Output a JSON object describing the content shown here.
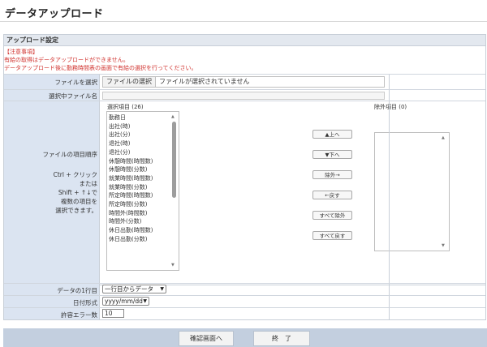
{
  "page": {
    "title": "データアップロード"
  },
  "section": {
    "header": "アップロード設定",
    "notice_label": "【注意事項】",
    "notice_lines": [
      "有給の取得はデータアップロードができません。",
      "データアップロード後に勤務時間表の画面で有給の選択を行ってください。"
    ]
  },
  "file_row": {
    "label": "ファイルを選択",
    "button_label": "ファイルの選択",
    "status": "ファイルが選択されていません"
  },
  "selected_row": {
    "label": "選択中ファイル名",
    "value": ""
  },
  "order_row": {
    "label": "ファイルの項目順序",
    "help_lines": [
      "Ctrl + クリック",
      "または",
      "Shift + ↑↓で",
      "複数の項目を",
      "選択できます。"
    ],
    "selected_caption": "選択項目 (26)",
    "excluded_caption": "除外項目 (0)",
    "selected_items": [
      "勤務日",
      "出社(時)",
      "出社(分)",
      "退社(時)",
      "退社(分)",
      "休憩時間(時間数)",
      "休憩時間(分数)",
      "就業時間(時間数)",
      "就業時間(分数)",
      "所定時間(時間数)",
      "所定時間(分数)",
      "時間外(時間数)",
      "時間外(分数)",
      "休日出勤(時間数)",
      "休日出勤(分数)"
    ],
    "excluded_items": [],
    "buttons": {
      "up": "▲上へ",
      "down": "▼下へ",
      "exclude": "除外→",
      "restore": "←戻す",
      "exclude_all": "すべて除外",
      "restore_all": "すべて戻す"
    }
  },
  "first_row": {
    "label": "データの1行目",
    "value": "一行目からデータ"
  },
  "date_row": {
    "label": "日付形式",
    "value": "yyyy/mm/dd"
  },
  "error_row": {
    "label": "許容エラー数",
    "value": "10"
  },
  "footer": {
    "confirm_label": "確認画面へ",
    "end_label": "終　了"
  },
  "colors": {
    "label_bg": "#dbe4f1",
    "header_bg": "#e3e8ef",
    "notice_text": "#d0312d",
    "footer_bar": "#c3cfdf"
  }
}
